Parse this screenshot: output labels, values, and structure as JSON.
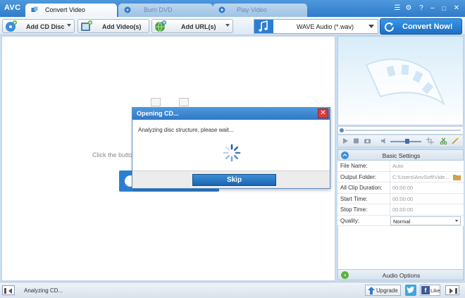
{
  "app": {
    "logo": "AVC"
  },
  "tabs": [
    {
      "label": "Convert Video",
      "active": true
    },
    {
      "label": "Burn DVD",
      "active": false
    },
    {
      "label": "Play Video",
      "active": false
    }
  ],
  "window_controls": [
    "menu-icon",
    "settings-icon",
    "help-icon",
    "minimize-icon",
    "close-icon"
  ],
  "toolbar": {
    "add_cd_label": "Add CD Disc",
    "add_video_label": "Add Video(s)",
    "add_url_label": "Add URL(s)",
    "output_format": "WAVE Audio (*.wav)",
    "convert_label": "Convert Now!"
  },
  "main": {
    "hint": "Click the butto"
  },
  "dialog": {
    "title": "Opening CD...",
    "message": "Analyzing disc structure, please wait...",
    "skip_label": "Skip"
  },
  "settings": {
    "header": "Basic Settings",
    "rows": [
      {
        "key": "File Name:",
        "value": "Auto"
      },
      {
        "key": "Output Folder:",
        "value": "C:\\Users\\AnvSoft\\Vide..."
      },
      {
        "key": "All Clip Duration:",
        "value": "00:00:00"
      },
      {
        "key": "Start Time:",
        "value": "00:00:00"
      },
      {
        "key": "Stop Time:",
        "value": "00:00:00"
      }
    ],
    "quality_label": "Quality:",
    "quality_value": "Normal"
  },
  "audio_options": {
    "header": "Audio Options"
  },
  "statusbar": {
    "status": "Analyzing CD...",
    "upgrade_label": "Upgrade",
    "like_label": "Like"
  },
  "colors": {
    "accent": "#2f7cc9",
    "convert_button": "#1c6fc4",
    "dialog_close": "#d93b3b"
  }
}
